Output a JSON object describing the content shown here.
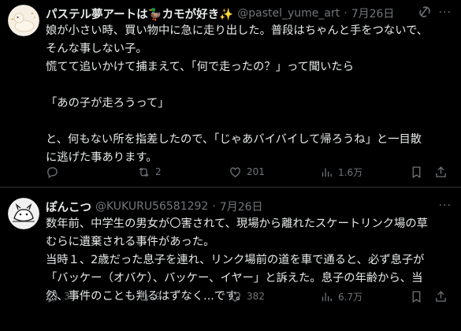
{
  "tweets": [
    {
      "name": "パステル夢アートは🦆カモが好き✨",
      "handle": "@pastel_yume_art",
      "sep": "·",
      "date": "7月26日",
      "lines": [
        "娘が小さい時、買い物中に急に走り出した。普段はちゃんと手をつないで、",
        "そんな事しない子。",
        "慌てて追いかけて捕まえて、「何で走ったの？」って聞いたら",
        "",
        "「あの子が走ろうって」",
        "",
        "と、何もない所を指差したので、「じゃあバイバイして帰ろうね」と一目散",
        "に逃げた事あります。"
      ],
      "replies": "",
      "retweets": "2",
      "likes": "201",
      "views": "1.6万"
    },
    {
      "name": "ぽんこつ",
      "handle": "@KUKURU56581292",
      "sep": "·",
      "date": "7月26日",
      "lines": [
        "数年前、中学生の男女が〇害されて、現場から離れたスケートリンク場の草",
        "むらに遺棄される事件があった。",
        "当時１、2歳だった息子を連れ、リンク場前の道を車で通ると、必ず息子が",
        "「バッケー（オバケ）、バッケー、イヤー」と訴えた。息子の年齢から、当",
        "然、事件のことも判るはずなく...です。"
      ],
      "replies": "3",
      "retweets": "9",
      "likes": "382",
      "views": "6.7万"
    }
  ],
  "more_label": "···",
  "colors": {
    "bg": "#000000",
    "text": "#e7e9ea",
    "muted": "#71767b",
    "divider": "#2f3336"
  }
}
